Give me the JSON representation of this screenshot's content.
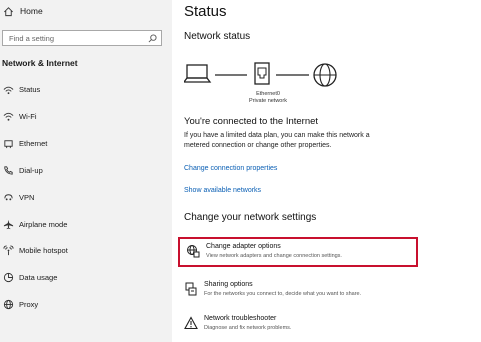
{
  "sidebar": {
    "home_label": "Home",
    "search_placeholder": "Find a setting",
    "section_title": "Network & Internet",
    "items": [
      {
        "label": "Status",
        "icon": "status-icon"
      },
      {
        "label": "Wi-Fi",
        "icon": "wifi-icon"
      },
      {
        "label": "Ethernet",
        "icon": "ethernet-icon"
      },
      {
        "label": "Dial-up",
        "icon": "phone-icon"
      },
      {
        "label": "VPN",
        "icon": "vpn-icon"
      },
      {
        "label": "Airplane mode",
        "icon": "airplane-icon"
      },
      {
        "label": "Mobile hotspot",
        "icon": "hotspot-icon"
      },
      {
        "label": "Data usage",
        "icon": "data-usage-icon"
      },
      {
        "label": "Proxy",
        "icon": "globe-icon"
      }
    ]
  },
  "main": {
    "title": "Status",
    "network_status_heading": "Network status",
    "adapter_name": "Ethernet0",
    "network_type": "Private network",
    "connected_heading": "You're connected to the Internet",
    "connected_desc": "If you have a limited data plan, you can make this network a metered connection or change other properties.",
    "link_change_props": "Change connection properties",
    "link_show_networks": "Show available networks",
    "change_settings_heading": "Change your network settings",
    "options": [
      {
        "title": "Change adapter options",
        "desc": "View network adapters and change connection settings.",
        "icon": "adapter-globe-icon"
      },
      {
        "title": "Sharing options",
        "desc": "For the networks you connect to, decide what you want to share.",
        "icon": "sharing-icon"
      },
      {
        "title": "Network troubleshooter",
        "desc": "Diagnose and fix network problems.",
        "icon": "warning-icon"
      }
    ]
  },
  "colors": {
    "sidebar_bg": "#f2f2f2",
    "link": "#0a5fb4",
    "highlight_border": "#c8102e"
  }
}
